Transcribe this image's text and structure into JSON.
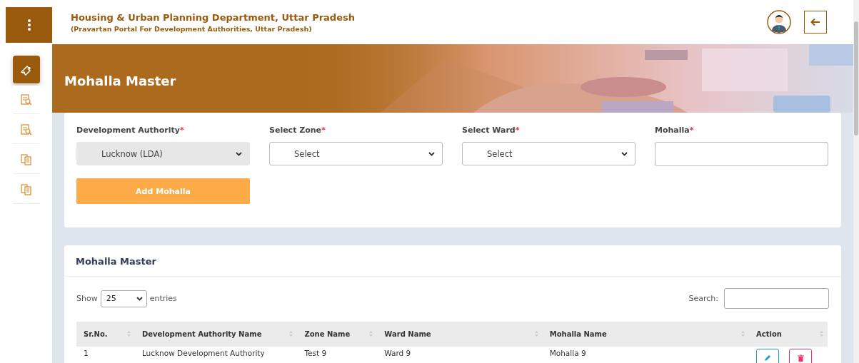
{
  "header": {
    "title": "Housing & Urban Planning Department, Uttar Pradesh",
    "subtitle": "(Pravartan Portal For Development Authorities, Uttar Pradesh)"
  },
  "sidebar": {
    "items": [
      {
        "kind": "puzzle",
        "selected": true
      },
      {
        "kind": "search-doc",
        "selected": false
      },
      {
        "kind": "search-doc",
        "selected": false
      },
      {
        "kind": "copy-doc",
        "selected": false
      },
      {
        "kind": "copy-doc",
        "selected": false
      }
    ]
  },
  "banner": {
    "title": "Mohalla Master",
    "kind": "picture"
  },
  "form": {
    "fields": [
      {
        "label": "Development Authority",
        "required_mark": "*",
        "kind": "select",
        "value": "Lucknow (LDA)",
        "disabled": true
      },
      {
        "label": "Select Zone",
        "required_mark": "*",
        "kind": "select",
        "value": "Select",
        "disabled": false
      },
      {
        "label": "Select Ward",
        "required_mark": "*",
        "kind": "select",
        "value": "Select",
        "disabled": false
      },
      {
        "label": "Mohalla",
        "required_mark": "*",
        "kind": "text"
      }
    ],
    "submit": "Add Mohalla"
  },
  "table": {
    "title": "Mohalla Master",
    "show_label": "Show",
    "page_size": "25",
    "entries_label": "entries",
    "search_label": "Search:",
    "columns": [
      "Sr.No.",
      "Development Authority Name",
      "Zone Name",
      "Ward Name",
      "Mohalla Name",
      "Action"
    ],
    "rows": [
      {
        "cells": [
          "1",
          "Lucknow Development Authority",
          "Test 9",
          "Ward 9",
          "Mohalla 9"
        ]
      }
    ]
  }
}
